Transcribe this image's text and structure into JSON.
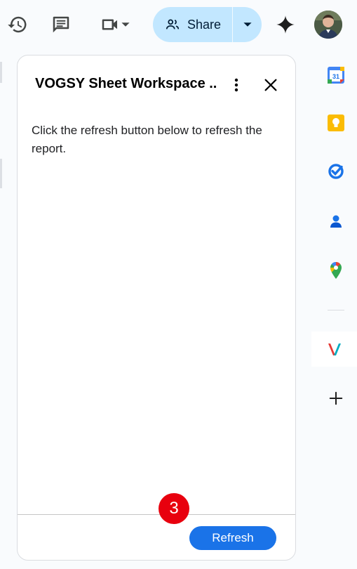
{
  "toolbar": {
    "share_label": "Share"
  },
  "panel": {
    "title": "VOGSY Sheet Workspace ...",
    "body_text": "Click the refresh button below to refresh the report.",
    "refresh_label": "Refresh",
    "step_badge": "3"
  },
  "sidebar": {
    "calendar_day": "31",
    "apps": [
      "calendar-icon",
      "keep-icon",
      "tasks-icon",
      "contacts-icon",
      "maps-icon",
      "vogsy-icon",
      "add-icon"
    ]
  },
  "colors": {
    "share_bg": "#c2e7ff",
    "refresh_bg": "#1a73e8",
    "badge_bg": "#e8000e"
  }
}
